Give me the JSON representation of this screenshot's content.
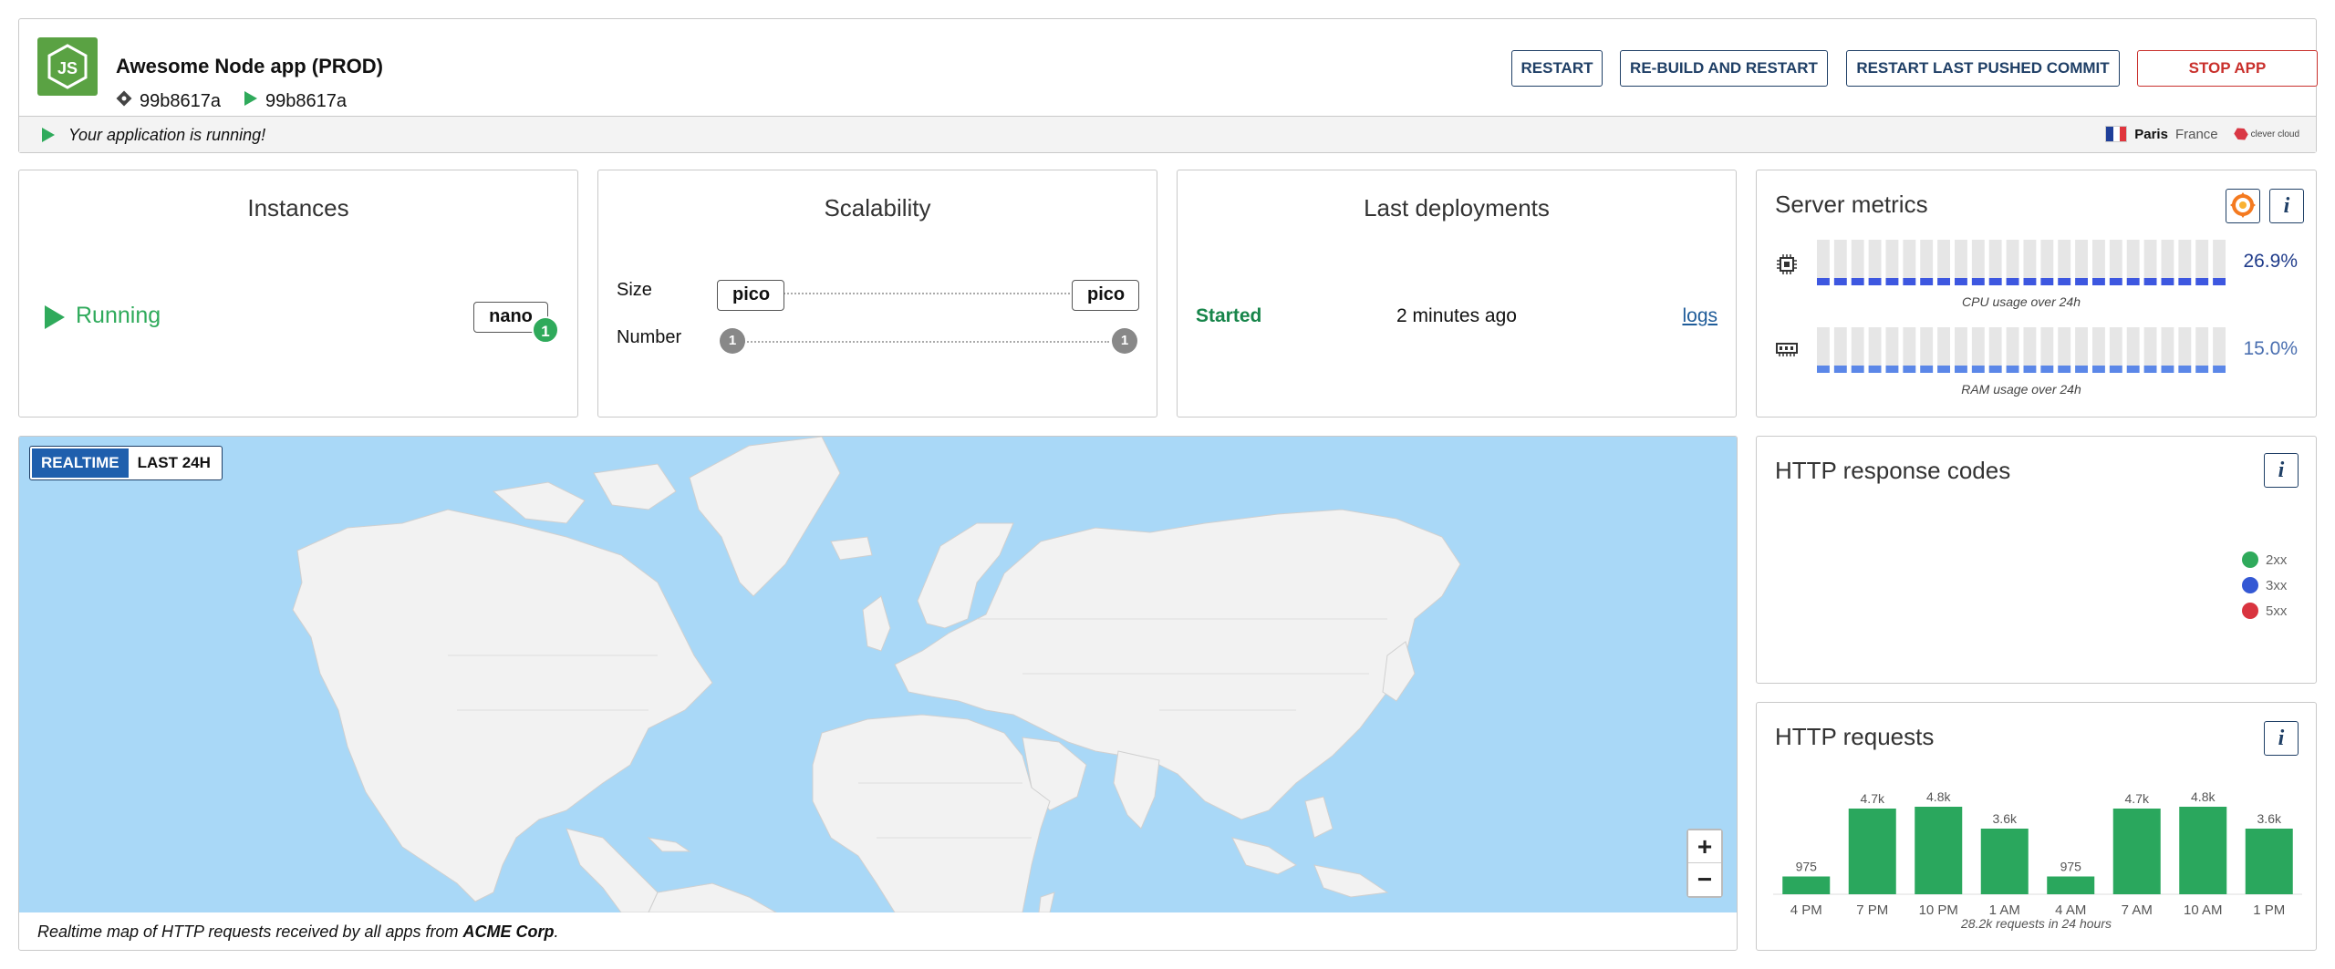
{
  "header": {
    "app_name": "Awesome Node app (PROD)",
    "logo_icon": "nodejs-logo-icon",
    "deployed_commit": "99b8617a",
    "running_commit": "99b8617a",
    "buttons": {
      "restart": "RESTART",
      "rebuild": "RE-BUILD AND RESTART",
      "restart_commit": "RESTART LAST PUSHED COMMIT",
      "stop": "STOP APP"
    },
    "status_text": "Your application is running!",
    "region_city": "Paris",
    "region_country": "France",
    "brand": "clever cloud"
  },
  "instances": {
    "title": "Instances",
    "state": "Running",
    "flavor": "nano",
    "count": "1"
  },
  "scalability": {
    "title": "Scalability",
    "size_label": "Size",
    "number_label": "Number",
    "size_min": "pico",
    "size_max": "pico",
    "number_min": "1",
    "number_max": "1"
  },
  "deployments": {
    "title": "Last deployments",
    "state": "Started",
    "time": "2 minutes ago",
    "logs_link": "logs"
  },
  "metrics": {
    "title": "Server metrics",
    "cpu_value": "26.9%",
    "cpu_fraction": 0.269,
    "cpu_caption": "CPU usage over 24h",
    "ram_value": "15.0%",
    "ram_fraction": 0.15,
    "ram_caption": "RAM usage over 24h",
    "cpu_color": "#3d57e0",
    "ram_color": "#5b87e8"
  },
  "http_codes": {
    "title": "HTTP response codes",
    "legend": [
      "2xx",
      "3xx",
      "5xx"
    ],
    "colors": [
      "#2faa5b",
      "#3458d4",
      "#d9343f"
    ]
  },
  "http_requests": {
    "title": "HTTP requests",
    "caption": "28.2k requests in 24 hours"
  },
  "map": {
    "toggle_realtime": "REALTIME",
    "toggle_last24": "LAST 24H",
    "zoom_in": "+",
    "zoom_out": "−",
    "caption_prefix": "Realtime map of HTTP requests received by all apps from ",
    "caption_org": "ACME Corp",
    "caption_suffix": "."
  },
  "chart_data": [
    {
      "type": "pie",
      "title": "HTTP response codes",
      "categories": [
        "2xx",
        "3xx",
        "5xx"
      ],
      "values": [
        0,
        0,
        0
      ]
    },
    {
      "type": "bar",
      "title": "HTTP requests",
      "categories": [
        "4 PM",
        "7 PM",
        "10 PM",
        "1 AM",
        "4 AM",
        "7 AM",
        "10 AM",
        "1 PM"
      ],
      "values": [
        975,
        4700,
        4800,
        3600,
        975,
        4700,
        4800,
        3600
      ],
      "labels": [
        "975",
        "4.7k",
        "4.8k",
        "3.6k",
        "975",
        "4.7k",
        "4.8k",
        "3.6k"
      ],
      "color": "#2aa75d"
    }
  ]
}
